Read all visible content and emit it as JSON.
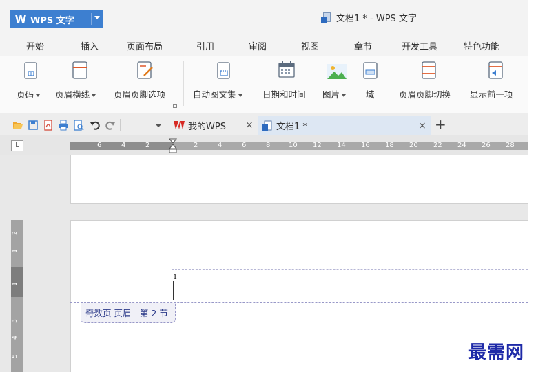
{
  "titlebar": {
    "app_name": "WPS 文字",
    "app_logo": "W",
    "window_title": "文档1 * - WPS 文字"
  },
  "menu": [
    "开始",
    "插入",
    "页面布局",
    "引用",
    "审阅",
    "视图",
    "章节",
    "开发工具",
    "特色功能"
  ],
  "ribbon": {
    "page_number": "页码",
    "header_line": "页眉横线",
    "header_footer_options": "页眉页脚选项",
    "auto_text": "自动图文集",
    "date_time": "日期和时间",
    "picture": "图片",
    "field": "域",
    "header_footer_switch": "页眉页脚切换",
    "show_previous": "显示前一项"
  },
  "tabs": {
    "my_wps": "我的WPS",
    "doc": "文档1 *",
    "close": "×",
    "add": "+"
  },
  "ruler": {
    "corner": "L",
    "h_ticks": [
      "6",
      "4",
      "2",
      "2",
      "4",
      "6",
      "8",
      "10",
      "12",
      "14",
      "16",
      "18",
      "20",
      "22",
      "24",
      "26",
      "28"
    ],
    "v_ticks": [
      "2",
      "1",
      "1",
      "3",
      "4",
      "5"
    ]
  },
  "document": {
    "header_content": "1",
    "header_tag": "奇数页 页眉 - 第 2 节-"
  },
  "watermark": "最需网",
  "colors": {
    "accent": "#3d7fd0",
    "header_tag_text": "#2d3b8a",
    "watermark": "#1e2aa8"
  }
}
